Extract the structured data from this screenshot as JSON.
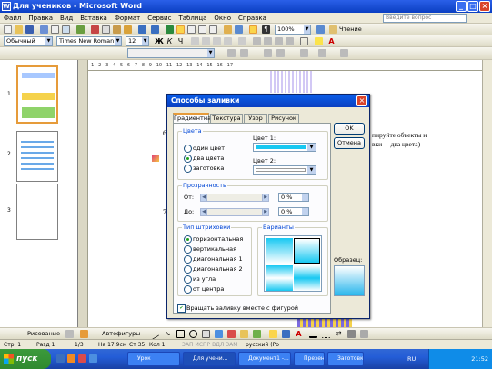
{
  "window": {
    "title": "Для учеников - Microsoft Word",
    "help_placeholder": "Введите вопрос"
  },
  "menu": [
    "Файл",
    "Правка",
    "Вид",
    "Вставка",
    "Формат",
    "Сервис",
    "Таблица",
    "Окно",
    "Справка"
  ],
  "formatting": {
    "style": "Обычный",
    "font": "Times New Roman",
    "size": "12",
    "zoom": "100%",
    "read_label": "Чтение"
  },
  "pages": [
    "1",
    "2",
    "3"
  ],
  "document": {
    "line1": "пируйте объекты и",
    "line2": "вки→ два цвета)",
    "num6": "6",
    "num7": "7"
  },
  "dialog": {
    "title": "Способы заливки",
    "tabs": [
      "Градиентная",
      "Текстура",
      "Узор",
      "Рисунок"
    ],
    "colors_group": "Цвета",
    "color_options": [
      "один цвет",
      "два цвета",
      "заготовка"
    ],
    "selected_color_option": "два цвета",
    "color1_label": "Цвет 1:",
    "color2_label": "Цвет 2:",
    "color1_value": "#18c8f2",
    "color2_value": "#ffffff",
    "transparency_group": "Прозрачность",
    "from_label": "От:",
    "to_label": "До:",
    "from_value": "0 %",
    "to_value": "0 %",
    "shading_group": "Тип штриховки",
    "shading_options": [
      "горизонтальная",
      "вертикальная",
      "диагональная 1",
      "диагональная 2",
      "из угла",
      "от центра"
    ],
    "selected_shading": "горизонтальная",
    "variants_label": "Варианты",
    "sample_label": "Образец:",
    "rotate_label": "Вращать заливку вместе с фигурой",
    "ok": "OK",
    "cancel": "Отмена"
  },
  "drawing_toolbar": {
    "draw_label": "Рисование",
    "autoshapes_label": "Автофигуры"
  },
  "status": {
    "page": "Стр. 1",
    "section": "Разд 1",
    "pages": "1/3",
    "at": "На 17,9см",
    "line": "Ст 35",
    "col": "Кол 1",
    "modes": "ЗАП  ИСПР  ВДЛ  ЗАМ",
    "lang": "русский (Ро"
  },
  "taskbar": {
    "start": "пуск",
    "tasks": [
      "Урок",
      "Для учени...",
      "Документ1 -...",
      "Презентация1",
      "Заготовка"
    ],
    "lang": "RU",
    "time": "21:52"
  }
}
